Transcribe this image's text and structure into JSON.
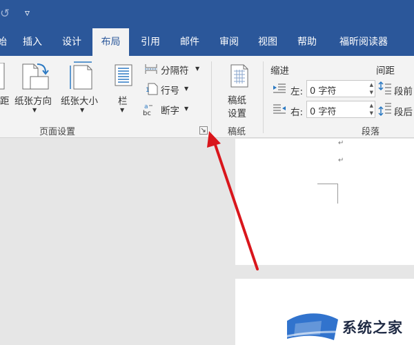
{
  "window": {
    "undo_glyph": "↺",
    "customize_glyph": "▿"
  },
  "tabs": [
    {
      "label": "始",
      "active": false
    },
    {
      "label": "插入",
      "active": false
    },
    {
      "label": "设计",
      "active": false
    },
    {
      "label": "布局",
      "active": true
    },
    {
      "label": "引用",
      "active": false
    },
    {
      "label": "邮件",
      "active": false
    },
    {
      "label": "审阅",
      "active": false
    },
    {
      "label": "视图",
      "active": false
    },
    {
      "label": "帮助",
      "active": false
    },
    {
      "label": "福昕阅读器",
      "active": false
    }
  ],
  "ribbon": {
    "page_setup": {
      "margins_label": "距",
      "orientation_label": "纸张方向",
      "size_label": "纸张大小",
      "columns_label": "栏",
      "breaks_label": "分隔符",
      "line_numbers_label": "行号",
      "hyphenation_label": "断字",
      "group_label": "页面设置"
    },
    "manuscript": {
      "button_label_1": "稿纸",
      "button_label_2": "设置",
      "group_label": "稿纸"
    },
    "paragraph": {
      "indent_header": "缩进",
      "spacing_header": "间距",
      "left_label": "左:",
      "left_value": "0 字符",
      "right_label": "右:",
      "right_value": "0 字符",
      "before_label": "段前",
      "after_label": "段后",
      "group_label": "段落"
    }
  },
  "document": {
    "paragraph_mark": "↵"
  },
  "watermark": {
    "text": "系统之家"
  },
  "colors": {
    "accent": "#2b579a",
    "arrow": "#d9161c"
  }
}
